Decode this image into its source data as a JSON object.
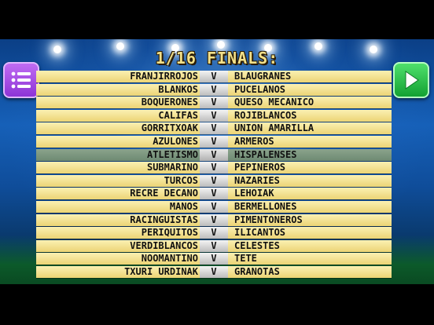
{
  "title": "1/16 FINALS:",
  "vs_label": "V",
  "icons": {
    "menu": "list-menu-icon",
    "next": "play-arrow-icon"
  },
  "colors": {
    "title": "#f2e08a",
    "row": "#f6e597",
    "highlight_row": "#7d967f",
    "menu_button": "#a44ee4",
    "next_button": "#22b540"
  },
  "matches": [
    {
      "home": "FRANJIRROJOS",
      "away": "BLAUGRANES"
    },
    {
      "home": "BLANKOS",
      "away": "PUCELANOS"
    },
    {
      "home": "BOQUERONES",
      "away": "QUESO MECANICO"
    },
    {
      "home": "CALIFAS",
      "away": "ROJIBLANCOS"
    },
    {
      "home": "GORRITXOAK",
      "away": "UNION AMARILLA"
    },
    {
      "home": "AZULONES",
      "away": "ARMEROS"
    },
    {
      "home": "ATLETISMO",
      "away": "HISPALENSES",
      "highlighted": true
    },
    {
      "home": "SUBMARINO",
      "away": "PEPINEROS"
    },
    {
      "home": "TURCOS",
      "away": "NAZARIES"
    },
    {
      "home": "RECRE DECANO",
      "away": "LEHOIAK"
    },
    {
      "home": "MANOS",
      "away": "BERMELLONES"
    },
    {
      "home": "RACINGUISTAS",
      "away": "PIMENTONEROS"
    },
    {
      "home": "PERIQUITOS",
      "away": "ILICANTOS"
    },
    {
      "home": "VERDIBLANCOS",
      "away": "CELESTES"
    },
    {
      "home": "NOOMANTINO",
      "away": "TETE"
    },
    {
      "home": "TXURI URDINAK",
      "away": "GRANOTAS"
    }
  ]
}
